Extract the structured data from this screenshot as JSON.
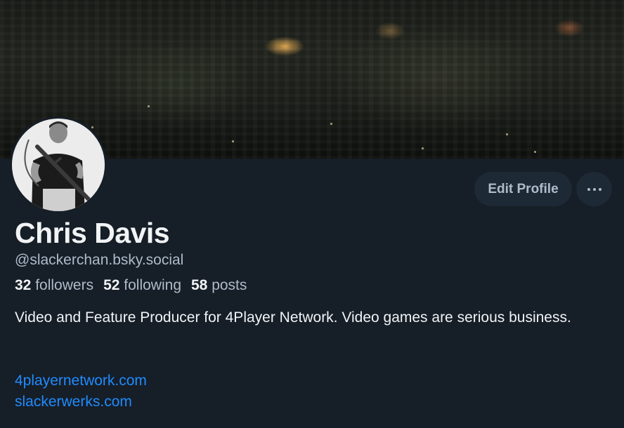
{
  "profile": {
    "display_name": "Chris Davis",
    "handle": "@slackerchan.bsky.social",
    "stats": {
      "followers_count": "32",
      "followers_label": "followers",
      "following_count": "52",
      "following_label": "following",
      "posts_count": "58",
      "posts_label": "posts"
    },
    "bio": "Video and Feature Producer for 4Player Network. Video games are serious business.",
    "links": [
      "4playernetwork.com",
      "slackerwerks.com"
    ]
  },
  "actions": {
    "edit_profile_label": "Edit Profile",
    "more_icon": "ellipsis-icon"
  },
  "colors": {
    "background": "#161e27",
    "button_bg": "#1e2936",
    "muted_text": "#aebbc9",
    "link": "#208bfe"
  }
}
